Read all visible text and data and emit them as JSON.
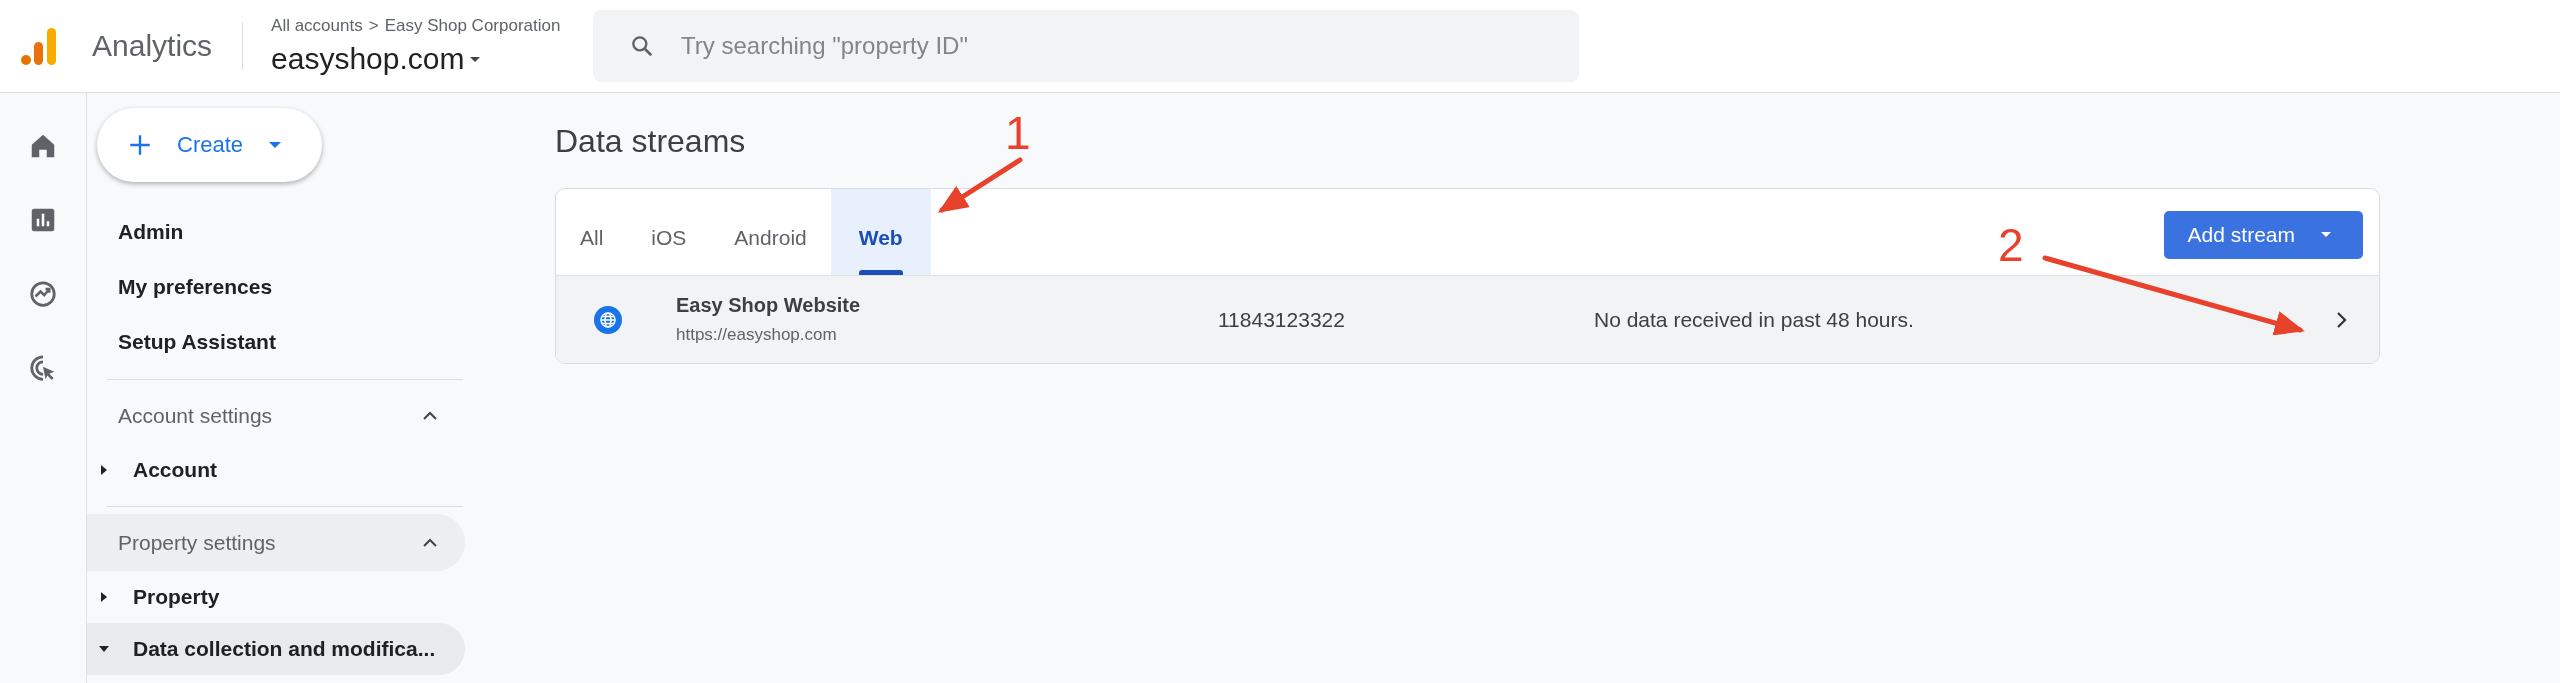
{
  "header": {
    "product": "Analytics",
    "breadcrumb": {
      "parent": "All accounts",
      "separator": ">",
      "current": "Easy Shop Corporation"
    },
    "property": "easyshop.com",
    "search": {
      "placeholder": "Try searching \"property ID\""
    }
  },
  "rail": [
    {
      "kind": "home"
    },
    {
      "kind": "reports"
    },
    {
      "kind": "explore"
    },
    {
      "kind": "advertising"
    }
  ],
  "create_button": {
    "label": "Create"
  },
  "nav": [
    {
      "kind": "link",
      "label": "Admin"
    },
    {
      "kind": "link",
      "label": "My preferences"
    },
    {
      "kind": "link",
      "label": "Setup Assistant"
    },
    {
      "kind": "section",
      "label": "Account settings",
      "expanded": true,
      "selected": false
    },
    {
      "kind": "node",
      "label": "Account",
      "expanded": false,
      "selected": false
    },
    {
      "kind": "section",
      "label": "Property settings",
      "expanded": true,
      "selected": true
    },
    {
      "kind": "node",
      "label": "Property",
      "expanded": false,
      "selected": false
    },
    {
      "kind": "node",
      "label": "Data collection and modifica...",
      "expanded": true,
      "selected": true
    }
  ],
  "page_title": "Data streams",
  "tabs": [
    {
      "label": "All",
      "selected": false
    },
    {
      "label": "iOS",
      "selected": false
    },
    {
      "label": "Android",
      "selected": false
    },
    {
      "label": "Web",
      "selected": true
    }
  ],
  "add_stream_button": {
    "label": "Add stream"
  },
  "streams": [
    {
      "name": "Easy Shop Website",
      "url": "https://easyshop.com",
      "stream_id": "11843123322",
      "status": "No data received in past 48 hours."
    }
  ],
  "annotations": [
    {
      "label": "1"
    },
    {
      "label": "2"
    }
  ]
}
